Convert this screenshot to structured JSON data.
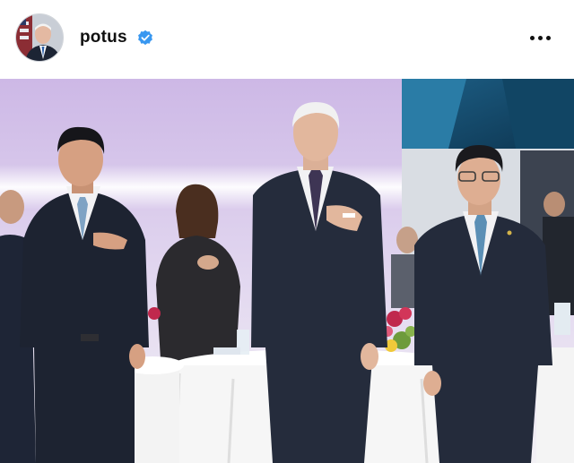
{
  "post": {
    "username": "potus",
    "verified": true,
    "more_icon": "more-horizontal-icon",
    "accent_color": "#3897f0"
  },
  "photo": {
    "subject": "photo"
  }
}
